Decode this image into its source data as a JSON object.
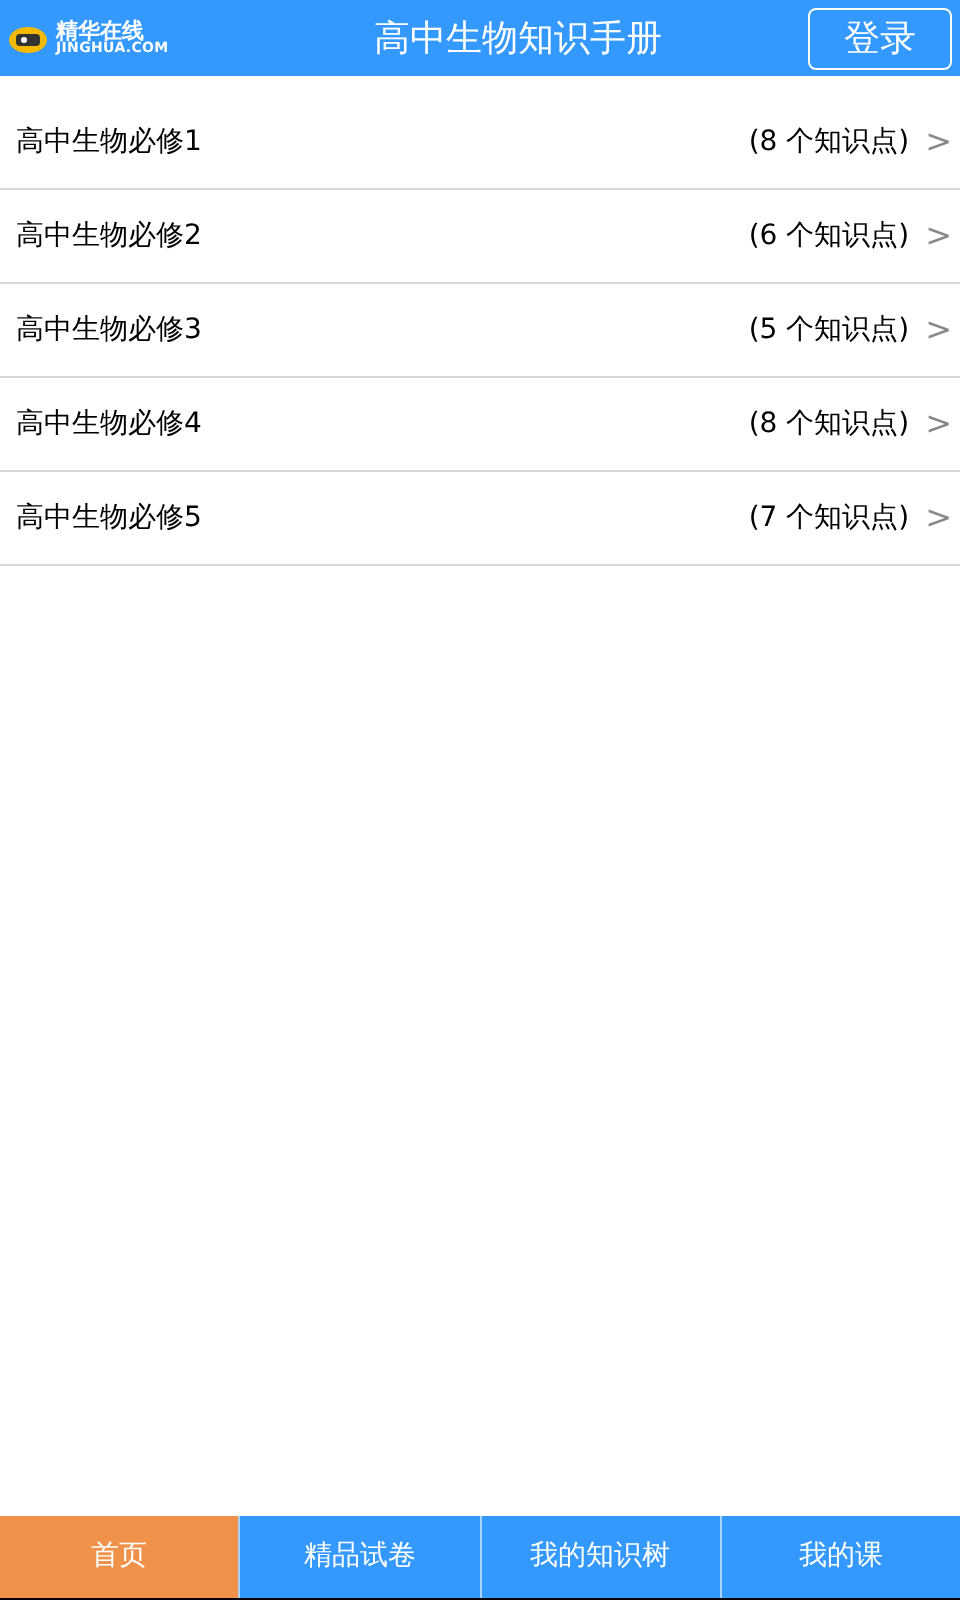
{
  "header": {
    "logo_name": "精华在线",
    "logo_domain": "JINGHUA.COM",
    "title": "高中生物知识手册",
    "login_button": "登录"
  },
  "items": [
    {
      "title": "高中生物必修1",
      "count": "(8 个知识点)",
      "arrow": ">"
    },
    {
      "title": "高中生物必修2",
      "count": "(6 个知识点)",
      "arrow": ">"
    },
    {
      "title": "高中生物必修3",
      "count": "(5 个知识点)",
      "arrow": ">"
    },
    {
      "title": "高中生物必修4",
      "count": "(8 个知识点)",
      "arrow": ">"
    },
    {
      "title": "高中生物必修5",
      "count": "(7 个知识点)",
      "arrow": ">"
    }
  ],
  "tabs": [
    {
      "label": "首页",
      "selected": true
    },
    {
      "label": "精品试卷",
      "selected": false
    },
    {
      "label": "我的知识树",
      "selected": false
    },
    {
      "label": "我的课",
      "selected": false
    }
  ]
}
